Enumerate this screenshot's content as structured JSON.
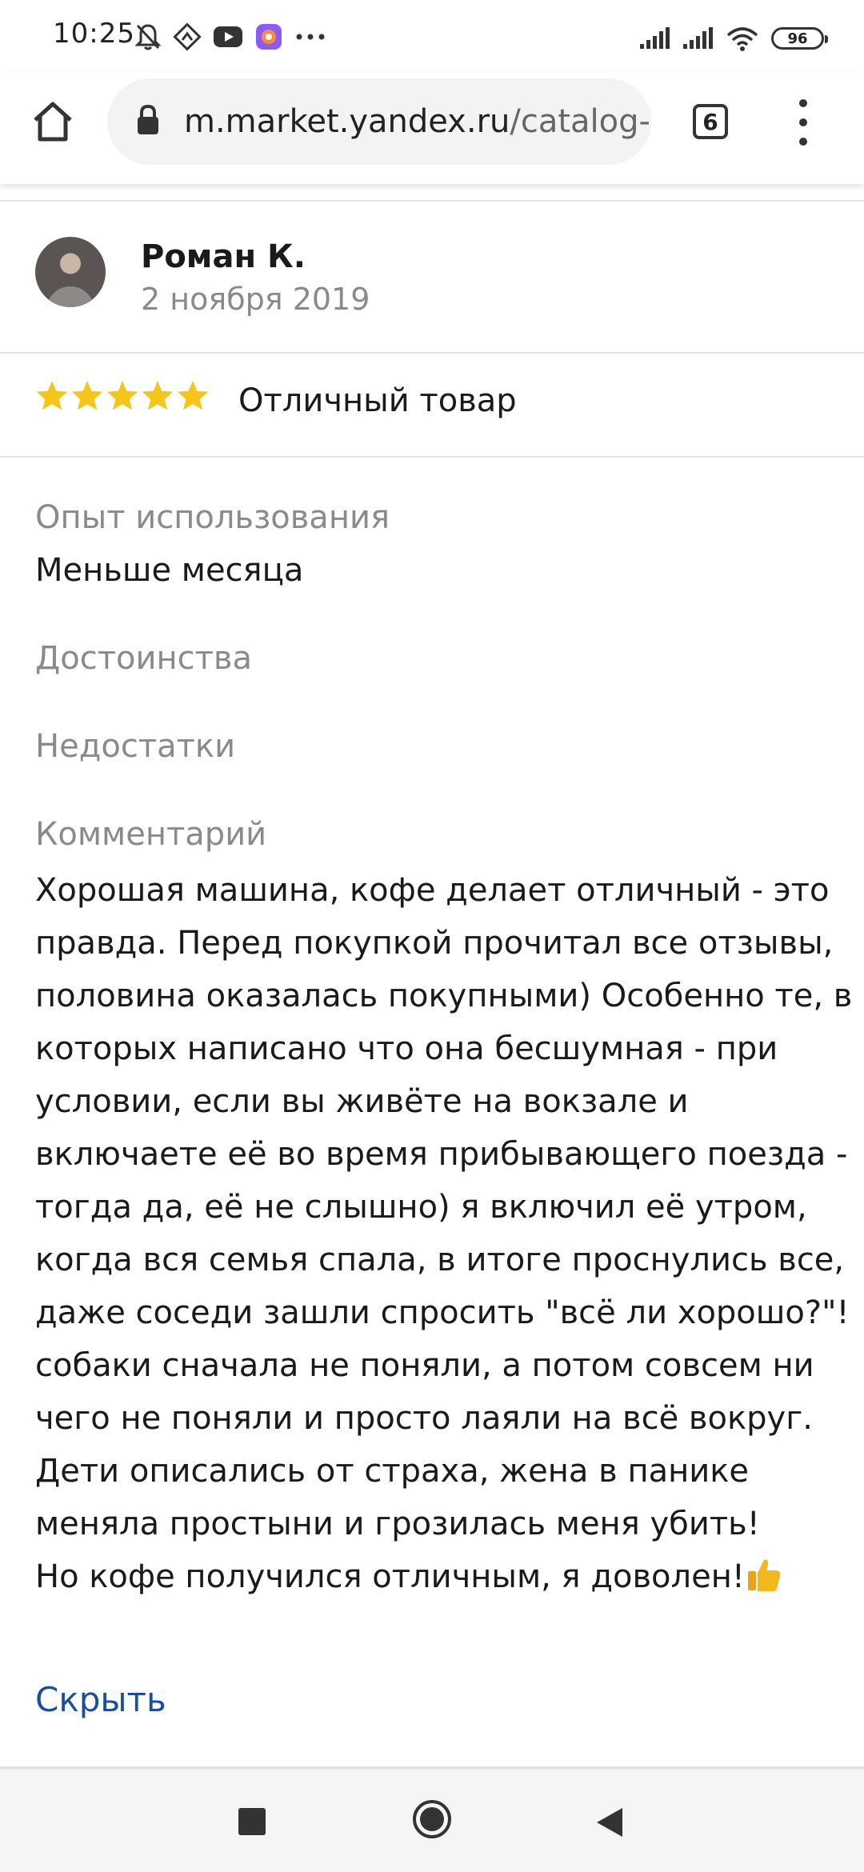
{
  "status_bar": {
    "time": "10:25",
    "battery": "96",
    "icons": [
      "mute-bell-icon",
      "maps-icon",
      "youtube-icon",
      "app-icon",
      "more-dots-icon",
      "signal-icon",
      "signal-icon",
      "wifi-icon",
      "battery-icon"
    ]
  },
  "browser": {
    "url_host": "m.market.yandex.ru",
    "url_path": "/catalog-",
    "tab_count": "6"
  },
  "review": {
    "author": "Роман К.",
    "date": "2 ноября 2019",
    "rating": 5,
    "rating_max": 5,
    "rating_text": "Отличный товар",
    "usage_label": "Опыт использования",
    "usage_value": "Меньше месяца",
    "pros_label": "Достоинства",
    "cons_label": "Недостатки",
    "comment_label": "Комментарий",
    "comment_lines": [
      "Хорошая машина, кофе делает отличный - это",
      "правда. Перед покупкой прочитал все отзывы,",
      "половина оказалась покупными) Особенно те, в",
      "которых написано что она бесшумная - при",
      "условии, если вы живёте на вокзале и",
      "включаете её во время прибывающего поезда -",
      "тогда да, её не слышно) я включил её утром,",
      "когда вся семья спала, в итоге проснулись все,",
      "даже соседи зашли спросить \"всё ли хорошо?\"!",
      " собаки сначала не поняли, а потом совсем ни",
      "чего не поняли и просто лаяли на всё вокруг.",
      "Дети описались от страха, жена в панике",
      "меняла простыни и грозилась меня убить!",
      "Но кофе получился отличным, я доволен!"
    ],
    "hide_label": "Скрыть"
  },
  "colors": {
    "star": "#f5c518",
    "link": "#1a4fa0",
    "muted": "#8a8a8a"
  }
}
